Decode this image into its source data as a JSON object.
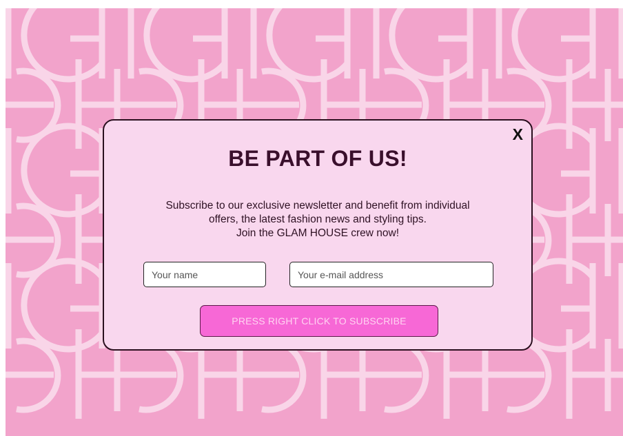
{
  "popup": {
    "close_label": "X",
    "headline": "BE PART OF US!",
    "description_lines": [
      "Subscribe to our exclusive newsletter and benefit from individual",
      "offers, the latest fashion news and styling tips.",
      "Join the GLAM HOUSE crew now!"
    ],
    "name_placeholder": "Your name",
    "email_placeholder": "Your e-mail address",
    "subscribe_label": "PRESS RIGHT CLICK TO SUBSCRIBE"
  },
  "colors": {
    "background": "#f2a3cb",
    "pattern": "#f9d5e8",
    "popup": "#f9d7ee",
    "button": "#f768d6"
  },
  "background_pattern": "repeating GH monogram"
}
